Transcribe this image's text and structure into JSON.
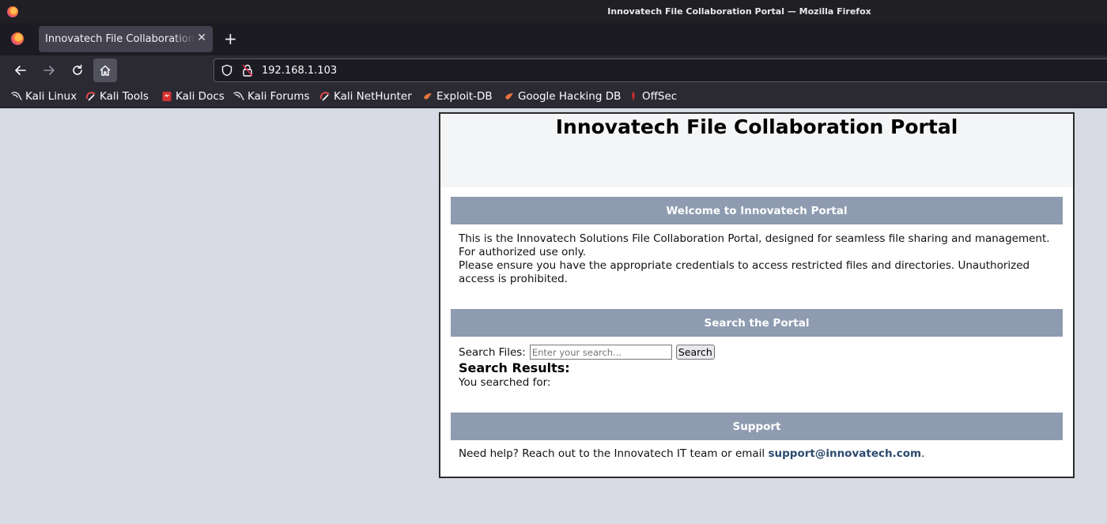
{
  "window": {
    "title": "Innovatech File Collaboration Portal — Mozilla Firefox"
  },
  "tabs": [
    {
      "label": "Innovatech File Collaboration Portal",
      "close_glyph": "✕"
    }
  ],
  "new_tab_glyph": "+",
  "navbar": {
    "url": "192.168.1.103"
  },
  "bookmarks": [
    {
      "label": "Kali Linux",
      "icon": "kali-dragon-icon"
    },
    {
      "label": "Kali Tools",
      "icon": "kali-tools-icon"
    },
    {
      "label": "Kali Docs",
      "icon": "kali-docs-icon"
    },
    {
      "label": "Kali Forums",
      "icon": "kali-dragon-icon"
    },
    {
      "label": "Kali NetHunter",
      "icon": "kali-tools-icon"
    },
    {
      "label": "Exploit-DB",
      "icon": "exploit-db-icon"
    },
    {
      "label": "Google Hacking DB",
      "icon": "exploit-db-icon"
    },
    {
      "label": "OffSec",
      "icon": "offsec-icon"
    }
  ],
  "page": {
    "title": "Innovatech File Collaboration Portal",
    "welcome": {
      "heading": "Welcome to Innovatech Portal",
      "line1": "This is the Innovatech Solutions File Collaboration Portal, designed for seamless file sharing and management. For authorized use only.",
      "line2": "Please ensure you have the appropriate credentials to access restricted files and directories. Unauthorized access is prohibited."
    },
    "search": {
      "heading": "Search the Portal",
      "label": "Search Files:",
      "placeholder": "Enter your search...",
      "button": "Search",
      "results_title": "Search Results:",
      "results_text": "You searched for:"
    },
    "support": {
      "heading": "Support",
      "text": "Need help? Reach out to the Innovatech IT team or email ",
      "email": "support@innovatech.com",
      "suffix": "."
    }
  },
  "colors": {
    "section_bar": "#8e9bb0",
    "link": "#2c4a6e",
    "page_bg": "#d8dbe4"
  }
}
